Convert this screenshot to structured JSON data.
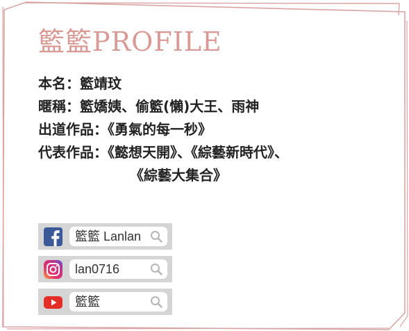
{
  "title": "籃籃PROFILE",
  "profile": {
    "real_name": "本名：籃靖玟",
    "nickname": "暱稱：籃嬌姨、偷籃(懶)大王、雨神",
    "debut": "出道作品：《勇氣的每一秒》",
    "works_line1": "代表作品：《懿想天開》、《綜藝新時代》、",
    "works_line2": "《綜藝大集合》"
  },
  "social": {
    "facebook": {
      "icon": "facebook-icon",
      "value": "籃籃 Lanlan"
    },
    "instagram": {
      "icon": "instagram-icon",
      "value": "lan0716"
    },
    "youtube": {
      "icon": "youtube-icon",
      "value": "籃籃"
    }
  },
  "colors": {
    "accent": "#d99a95",
    "frame": "#d9a3a3",
    "facebook": "#3b5998",
    "youtube": "#e52d27"
  }
}
